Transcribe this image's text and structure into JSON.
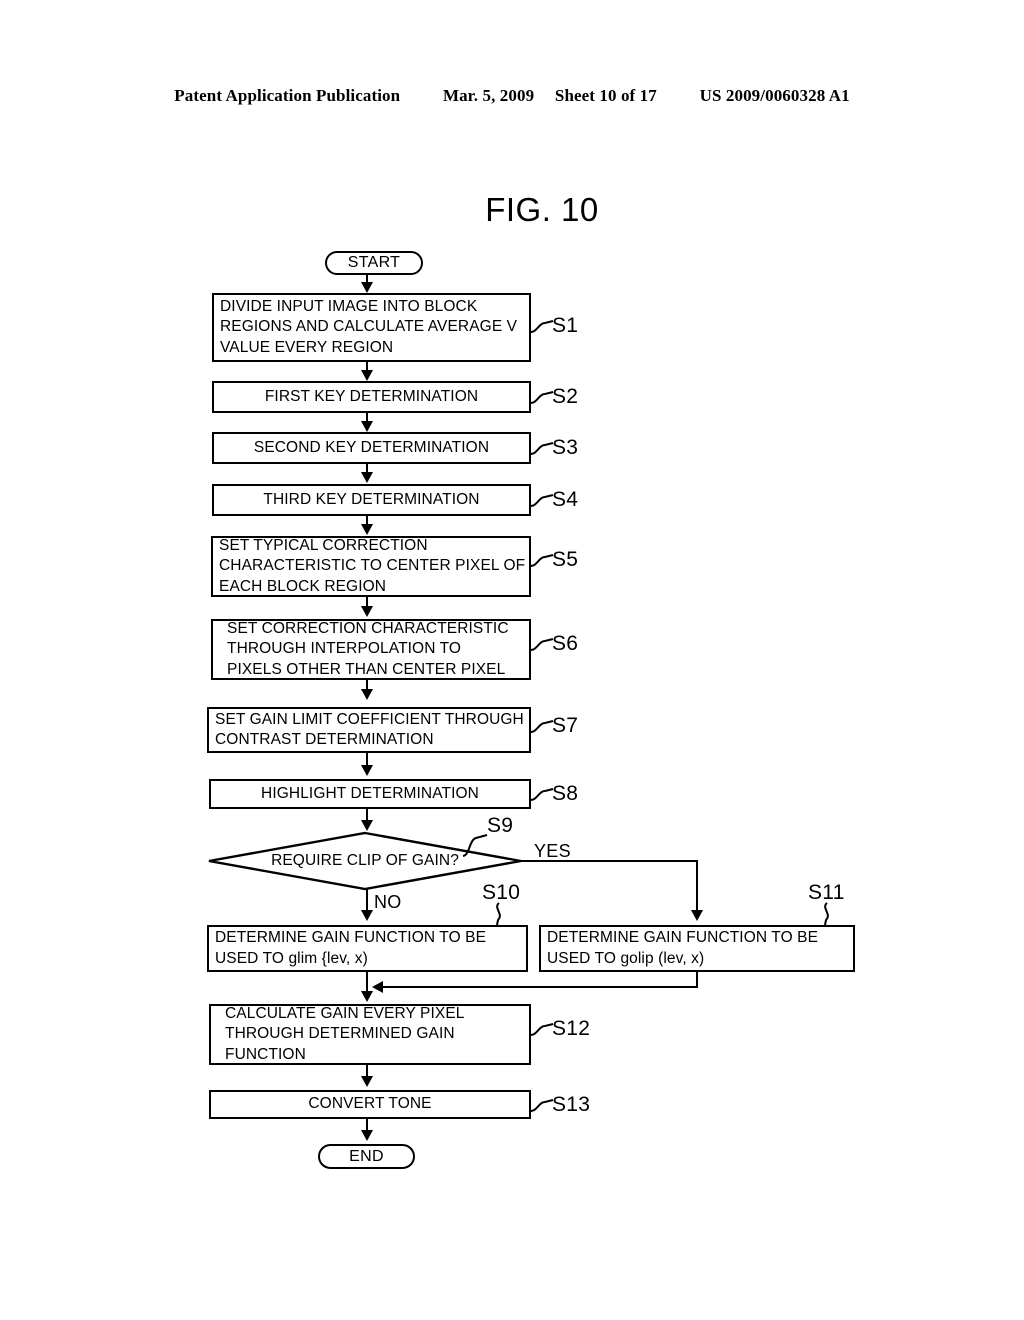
{
  "header": {
    "publication": "Patent Application Publication",
    "date": "Mar. 5, 2009",
    "sheet": "Sheet 10 of 17",
    "patent_number": "US 2009/0060328 A1"
  },
  "figure": {
    "title": "FIG. 10"
  },
  "flowchart": {
    "start_label": "START",
    "end_label": "END",
    "nodes": [
      {
        "id": "S1",
        "ref": "S1",
        "type": "process",
        "lines": [
          "DIVIDE INPUT IMAGE INTO BLOCK",
          "REGIONS AND CALCULATE AVERAGE V",
          "VALUE EVERY REGION"
        ]
      },
      {
        "id": "S2",
        "ref": "S2",
        "type": "process",
        "lines": [
          "FIRST KEY DETERMINATION"
        ]
      },
      {
        "id": "S3",
        "ref": "S3",
        "type": "process",
        "lines": [
          "SECOND KEY DETERMINATION"
        ]
      },
      {
        "id": "S4",
        "ref": "S4",
        "type": "process",
        "lines": [
          "THIRD KEY DETERMINATION"
        ]
      },
      {
        "id": "S5",
        "ref": "S5",
        "type": "process",
        "lines": [
          "SET TYPICAL CORRECTION",
          "CHARACTERISTIC TO CENTER PIXEL OF",
          "EACH BLOCK REGION"
        ]
      },
      {
        "id": "S6",
        "ref": "S6",
        "type": "process",
        "lines": [
          "SET CORRECTION CHARACTERISTIC",
          "THROUGH INTERPOLATION TO",
          "PIXELS OTHER THAN CENTER PIXEL"
        ]
      },
      {
        "id": "S7",
        "ref": "S7",
        "type": "process",
        "lines": [
          "SET GAIN LIMIT COEFFICIENT THROUGH",
          "CONTRAST DETERMINATION"
        ]
      },
      {
        "id": "S8",
        "ref": "S8",
        "type": "process",
        "lines": [
          "HIGHLIGHT DETERMINATION"
        ]
      },
      {
        "id": "S9",
        "ref": "S9",
        "type": "decision",
        "lines": [
          "REQUIRE CLIP OF GAIN?"
        ],
        "branch_yes": "YES",
        "branch_no": "NO"
      },
      {
        "id": "S10",
        "ref": "S10",
        "type": "process",
        "lines": [
          "DETERMINE GAIN FUNCTION TO BE",
          "USED TO glim {lev, x)"
        ]
      },
      {
        "id": "S11",
        "ref": "S11",
        "type": "process",
        "lines": [
          "DETERMINE GAIN FUNCTION TO BE",
          "USED TO golip (lev, x)"
        ]
      },
      {
        "id": "S12",
        "ref": "S12",
        "type": "process",
        "lines": [
          "CALCULATE GAIN EVERY PIXEL",
          "THROUGH DETERMINED GAIN",
          "FUNCTION"
        ]
      },
      {
        "id": "S13",
        "ref": "S13",
        "type": "process",
        "lines": [
          "CONVERT TONE"
        ]
      }
    ]
  },
  "colors": {
    "ink": "#000000",
    "paper": "#ffffff"
  }
}
